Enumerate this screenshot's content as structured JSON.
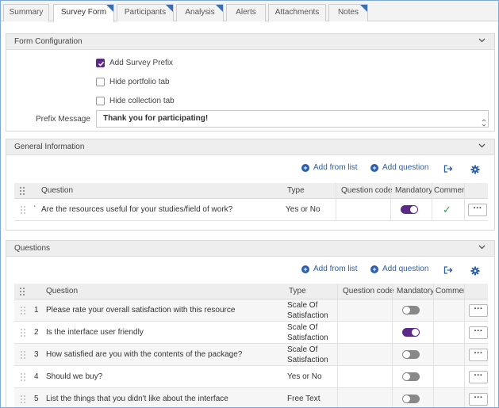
{
  "tabs": [
    {
      "label": "Summary",
      "active": false,
      "corner": false
    },
    {
      "label": "Survey Form",
      "active": true,
      "corner": true
    },
    {
      "label": "Participants",
      "active": false,
      "corner": true
    },
    {
      "label": "Analysis",
      "active": false,
      "corner": true
    },
    {
      "label": "Alerts",
      "active": false,
      "corner": false
    },
    {
      "label": "Attachments",
      "active": false,
      "corner": false
    },
    {
      "label": "Notes",
      "active": false,
      "corner": true
    }
  ],
  "form_config": {
    "title": "Form Configuration",
    "add_survey_prefix": {
      "label": "Add Survey Prefix",
      "checked": true
    },
    "hide_portfolio_tab": {
      "label": "Hide portfolio tab",
      "checked": false
    },
    "hide_collection_tab": {
      "label": "Hide collection tab",
      "checked": false
    },
    "prefix_message_label": "Prefix Message",
    "prefix_message_value": "Thank you for participating!"
  },
  "general_info": {
    "title": "General Information",
    "add_from_list": "Add from list",
    "add_question": "Add question",
    "columns": {
      "question": "Question",
      "type": "Type",
      "code": "Question code",
      "mandatory": "Mandatory",
      "comment": "Commen"
    },
    "rows": [
      {
        "num": "`",
        "question": "Are the resources useful for your studies/field of work?",
        "type": "Yes or No",
        "code": "",
        "mandatory": true,
        "comment": true
      }
    ]
  },
  "questions": {
    "title": "Questions",
    "add_from_list": "Add from list",
    "add_question": "Add question",
    "columns": {
      "question": "Question",
      "type": "Type",
      "code": "Question code",
      "mandatory": "Mandatory",
      "comment": "Commen"
    },
    "rows": [
      {
        "num": "1",
        "question": "Please rate your overall satisfaction with this resource",
        "type1": "Scale Of",
        "type2": "Satisfaction",
        "mandatory": false
      },
      {
        "num": "2",
        "question": "Is the interface user friendly",
        "type1": "Scale Of",
        "type2": "Satisfaction",
        "mandatory": true
      },
      {
        "num": "3",
        "question": "How satisfied are you with the contents of the package?",
        "type1": "Scale Of",
        "type2": "Satisfaction",
        "mandatory": false
      },
      {
        "num": "4",
        "question": "Should we buy?",
        "type1": "Yes or No",
        "type2": "",
        "mandatory": false
      },
      {
        "num": "5",
        "question": "List the things that you didn't like about the interface",
        "type1": "Free Text",
        "type2": "",
        "mandatory": false
      }
    ]
  },
  "more_label": "···",
  "check_glyph": "✓",
  "colors": {
    "accent": "#5b2a86",
    "link": "#2a5ea8",
    "success": "#2e9e4b"
  }
}
